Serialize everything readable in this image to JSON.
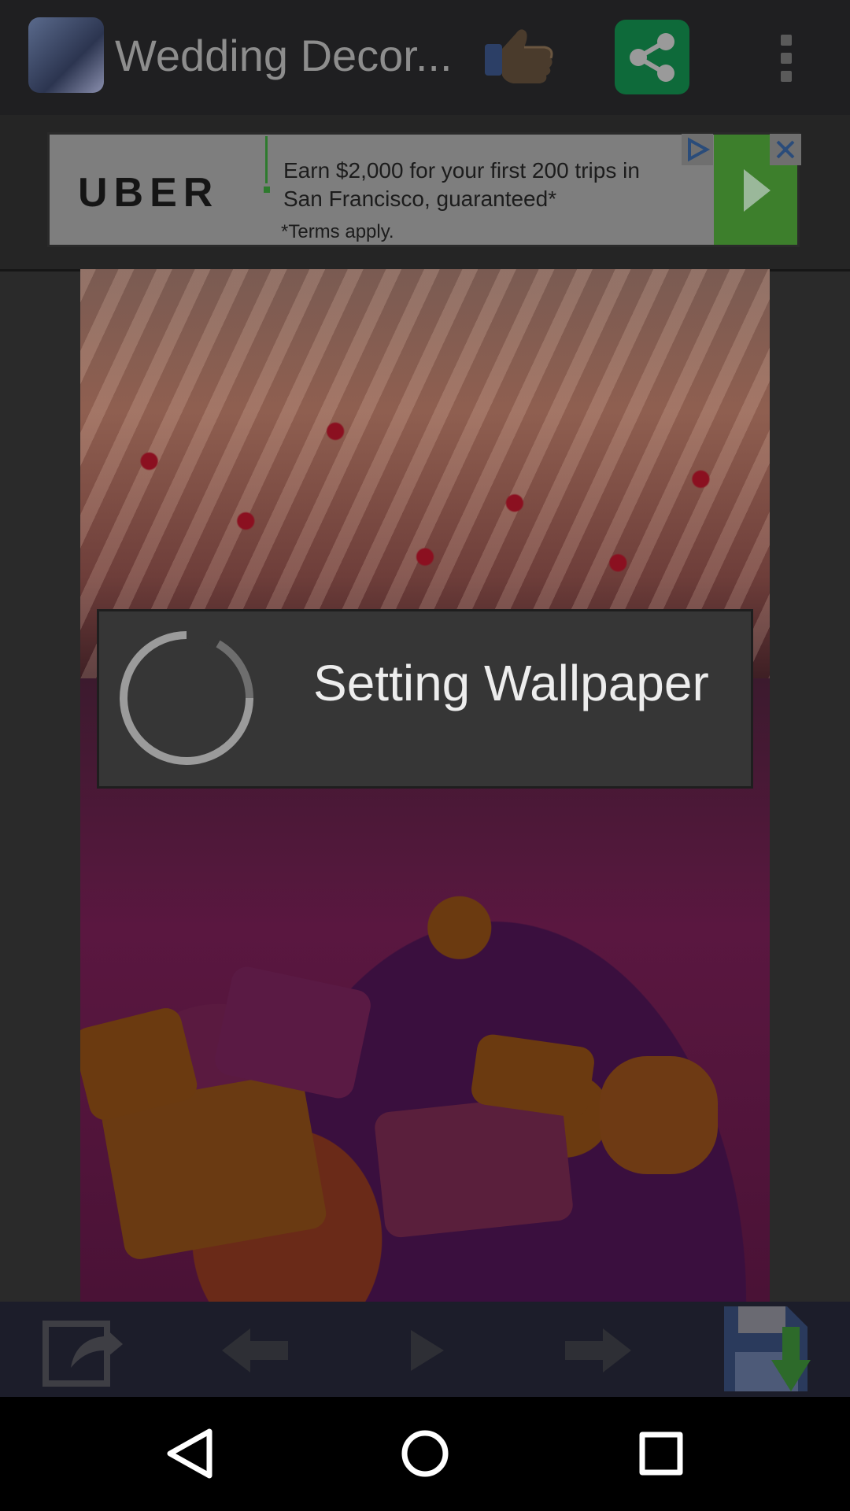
{
  "app": {
    "title": "Wedding Decor...",
    "icon": "app-thumbnail-icon",
    "like_icon": "thumbs-up-icon",
    "share_icon": "share-icon",
    "menu_icon": "overflow-menu-icon",
    "share_color": "#0e6a3a"
  },
  "ad": {
    "brand": "UBER",
    "headline": "Earn $2,000 for your first 200 trips in San Francisco, guaranteed*",
    "terms": "*Terms apply.",
    "cta_icon": "play-arrow-icon",
    "adchoices_icon": "adchoices-icon",
    "close_icon": "close-icon",
    "accent_color": "#3d7f2c"
  },
  "dialog": {
    "message": "Setting Wallpaper",
    "spinner_icon": "progress-spinner-icon"
  },
  "toolbar": {
    "items": [
      {
        "icon": "set-wallpaper-icon"
      },
      {
        "icon": "previous-arrow-icon"
      },
      {
        "icon": "play-icon"
      },
      {
        "icon": "next-arrow-icon"
      },
      {
        "icon": "save-download-icon"
      }
    ]
  },
  "navbar": {
    "back_icon": "back-triangle-icon",
    "home_icon": "home-circle-icon",
    "recents_icon": "recents-square-icon"
  }
}
